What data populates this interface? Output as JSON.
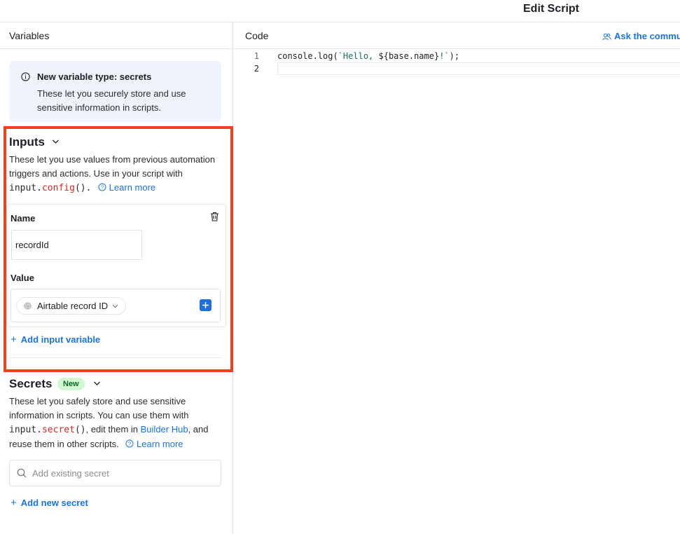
{
  "window": {
    "title": "Edit Script"
  },
  "variables_panel": {
    "header": "Variables",
    "info_box": {
      "title": "New variable type: secrets",
      "body": "These let you securely store and use sensitive information in scripts."
    },
    "inputs": {
      "title": "Inputs",
      "desc_1": "These let you use values from previous automation triggers and actions. Use in your script with ",
      "code_obj": "input",
      "code_fn": "config",
      "code_tail": "().",
      "learn_more": "Learn more",
      "variable": {
        "name_label": "Name",
        "name_value": "recordId",
        "value_label": "Value",
        "value_token": "Airtable record ID"
      },
      "add_button": "Add input variable"
    },
    "secrets": {
      "title": "Secrets",
      "badge": "New",
      "desc_1": "These let you safely store and use sensitive information in scripts. You can use them with ",
      "code_obj": "input",
      "code_fn": "secret",
      "code_tail": "()",
      "desc_2": ", edit them in ",
      "builder_hub": "Builder Hub",
      "desc_3": ", and reuse them in other scripts.",
      "learn_more": "Learn more",
      "search_placeholder": "Add existing secret",
      "add_button": "Add new secret"
    }
  },
  "code_panel": {
    "header": "Code",
    "ask_link": "Ask the commu",
    "lines": [
      {
        "num": "1",
        "pre": "console.log(",
        "str_open": "`Hello, ",
        "tmpl": "${base.name}",
        "str_close": "!`",
        "post": ");"
      },
      {
        "num": "2"
      }
    ]
  },
  "colors": {
    "accent": "#1a73d9",
    "highlight_border": "#f0401c",
    "badge_bg": "#cff5d1",
    "code_keyword": "#d12a2a"
  }
}
